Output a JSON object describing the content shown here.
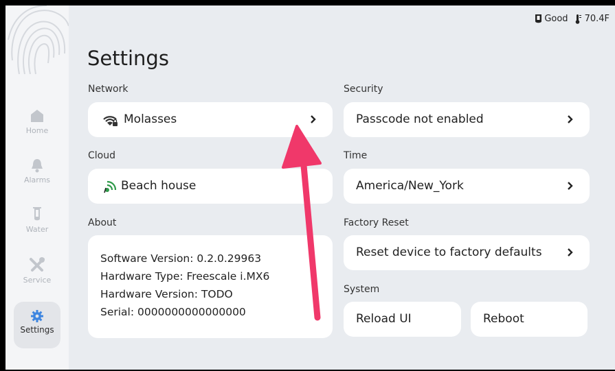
{
  "status": {
    "water_quality": "Good",
    "temperature": "70.4F"
  },
  "page_title": "Settings",
  "sidebar": {
    "items": [
      {
        "label": "Home",
        "icon": "home-icon",
        "active": false
      },
      {
        "label": "Alarms",
        "icon": "bell-icon",
        "active": false
      },
      {
        "label": "Water",
        "icon": "water-tube-icon",
        "active": false
      },
      {
        "label": "Service",
        "icon": "tools-icon",
        "active": false
      },
      {
        "label": "Settings",
        "icon": "gear-icon",
        "active": true
      }
    ]
  },
  "sections": {
    "network": {
      "label": "Network",
      "value": "Molasses",
      "icon": "wifi-lock-icon"
    },
    "cloud": {
      "label": "Cloud",
      "value": "Beach house",
      "icon": "cloud-signal-icon"
    },
    "about": {
      "label": "About",
      "lines": [
        "Software Version: 0.2.0.29963",
        "Hardware Type: Freescale i.MX6",
        "Hardware Version: TODO",
        "Serial: 0000000000000000"
      ]
    },
    "security": {
      "label": "Security",
      "value": "Passcode not enabled"
    },
    "time": {
      "label": "Time",
      "value": "America/New_York"
    },
    "factory_reset": {
      "label": "Factory Reset",
      "value": "Reset device to factory defaults"
    },
    "system": {
      "label": "System",
      "reload_label": "Reload UI",
      "reboot_label": "Reboot"
    }
  },
  "colors": {
    "accent": "#3f86e0",
    "annotation_arrow": "#f0386a",
    "background": "#e9ecf0"
  }
}
